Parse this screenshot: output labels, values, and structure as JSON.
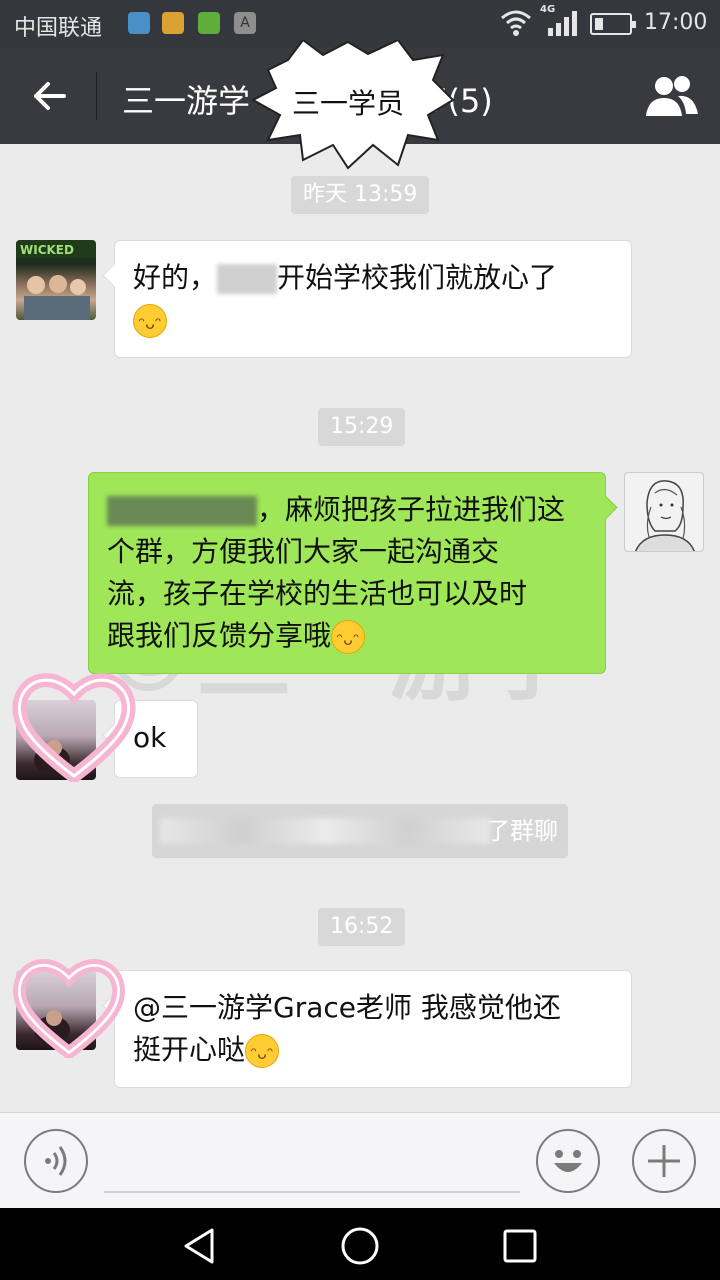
{
  "status_bar": {
    "carrier": "中国联通",
    "network": "4G",
    "time": "17:00",
    "app_icon_badge": "A"
  },
  "header": {
    "title": "三一游学",
    "title_suffix": "大学2017(5)",
    "sticker_text": "三一学员"
  },
  "messages": [
    {
      "type": "time",
      "text": "昨天 13:59"
    },
    {
      "type": "incoming",
      "text_before": "好的，",
      "text_after": "开始学校我们就放心了"
    },
    {
      "type": "time",
      "text": "15:29"
    },
    {
      "type": "outgoing",
      "line1": "，麻烦把孩子拉进我们这",
      "line2": "个群，方便我们大家一起沟通交",
      "line3": "流，孩子在学校的生活也可以及时",
      "line4": "跟我们反馈分享哦"
    },
    {
      "type": "incoming",
      "text": "ok"
    },
    {
      "type": "system",
      "text": "了群聊"
    },
    {
      "type": "time",
      "text": "16:52"
    },
    {
      "type": "incoming",
      "line1": "@三一游学Grace老师 我感觉他还",
      "line2": "挺开心哒"
    }
  ],
  "watermark": "©三一游学",
  "colors": {
    "header_bg": "#393a3f",
    "status_bg": "#34373c",
    "chat_bg": "#ebebeb",
    "outgoing_bubble": "#9fe658",
    "incoming_bubble": "#ffffff"
  }
}
